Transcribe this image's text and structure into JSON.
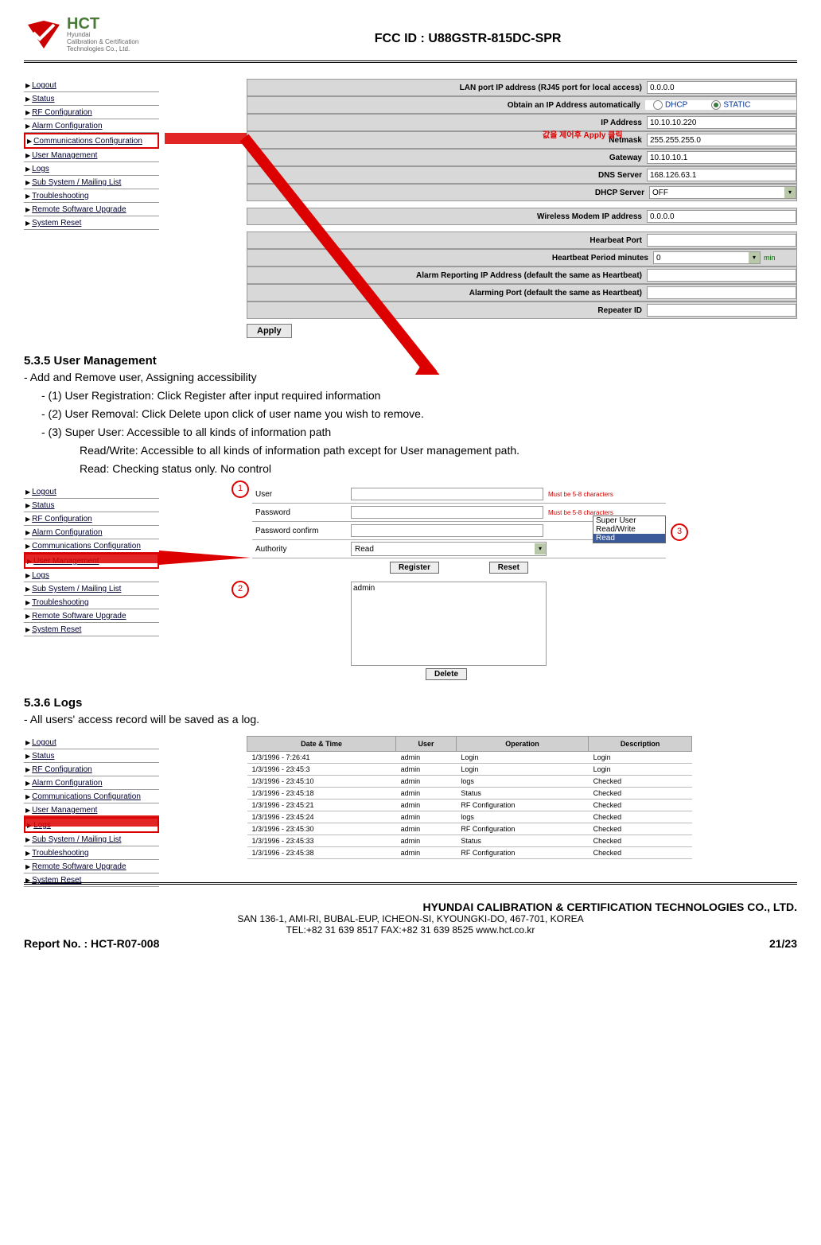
{
  "header": {
    "logo_main": "HCT",
    "logo_sub1": "Hyundai",
    "logo_sub2": "Calibration & Certification",
    "logo_sub3": "Technologies Co., Ltd.",
    "fcc_id": "FCC ID : U88GSTR-815DC-SPR"
  },
  "menu1": [
    "Logout",
    "Status",
    "RF Configuration",
    "Alarm Configuration",
    "Communications Configuration",
    "User Management",
    "Logs",
    "Sub System / Mailing List",
    "Troubleshooting",
    "Remote Software Upgrade",
    "System Reset"
  ],
  "menu1_highlight": 4,
  "comm_form": {
    "rows": [
      {
        "label": "LAN port IP address (RJ45 port for local access)",
        "value": "0.0.0.0",
        "type": "text"
      },
      {
        "label": "Obtain an IP Address automatically",
        "type": "radio",
        "opt1": "DHCP",
        "opt2": "STATIC",
        "checked": "STATIC"
      },
      {
        "label": "IP Address",
        "value": "10.10.10.220",
        "type": "text"
      },
      {
        "label": "Netmask",
        "value": "255.255.255.0",
        "type": "text"
      },
      {
        "label": "Gateway",
        "value": "10.10.10.1",
        "type": "text"
      },
      {
        "label": "DNS Server",
        "value": "168.126.63.1",
        "type": "text"
      },
      {
        "label": "DHCP Server",
        "value": "OFF",
        "type": "select"
      }
    ],
    "overlay_text": "값을 제어후 Apply 클릭",
    "wireless_label": "Wireless Modem IP address",
    "wireless_value": "0.0.0.0",
    "rows2": [
      {
        "label": "Hearbeat Port",
        "value": ""
      },
      {
        "label": "Heartbeat Period minutes",
        "value": "0",
        "unit": "min",
        "type": "select"
      },
      {
        "label": "Alarm Reporting IP Address (default the same as Heartbeat)",
        "value": ""
      },
      {
        "label": "Alarming Port (default the same as Heartbeat)",
        "value": ""
      },
      {
        "label": "Repeater ID",
        "value": ""
      }
    ],
    "apply_label": "Apply"
  },
  "section535": {
    "heading": "5.3.5 User Management",
    "line1": "-  Add and Remove user, Assigning accessibility",
    "line2": "-  (1) User Registration:  Click  Register  after input required information",
    "line3": "-  (2) User Removal:  Click Delete upon click of user name you wish to remove.",
    "line4": "-  (3)  Super  User:  Accessible to all kinds of information path",
    "line5": "Read/Write:  Accessible to all kinds of information path except for User  management  path.",
    "line6": "Read:  Checking status only. No control"
  },
  "menu2": [
    "Logout",
    "Status",
    "RF Configuration",
    "Alarm Configuration",
    "Communications Configuration",
    "User Management",
    "Logs",
    "Sub System / Mailing List",
    "Troubleshooting",
    "Remote Software Upgrade",
    "System Reset"
  ],
  "menu2_highlight": 5,
  "user_form": {
    "user_label": "User",
    "password_label": "Password",
    "confirm_label": "Password confirm",
    "auth_label": "Authority",
    "auth_value": "Read",
    "hint": "Must be 5-8 characters",
    "register": "Register",
    "reset": "Reset",
    "delete": "Delete",
    "userlist": [
      "admin"
    ],
    "dropdown": [
      "Super User",
      "Read/Write",
      "Read"
    ],
    "dropdown_sel": "Read"
  },
  "section536": {
    "heading": "5.3.6 Logs",
    "line1": "-  All users' access record will be saved as a log."
  },
  "menu3": [
    "Logout",
    "Status",
    "RF Configuration",
    "Alarm Configuration",
    "Communications Configuration",
    "User Management",
    "Logs",
    "Sub System / Mailing List",
    "Troubleshooting",
    "Remote Software Upgrade",
    "System Reset"
  ],
  "menu3_highlight": 6,
  "logs_table": {
    "headers": [
      "Date & Time",
      "User",
      "Operation",
      "Description"
    ],
    "rows": [
      [
        "1/3/1996 - 7:26:41",
        "admin",
        "Login",
        "Login"
      ],
      [
        "1/3/1996 - 23:45:3",
        "admin",
        "Login",
        "Login"
      ],
      [
        "1/3/1996 - 23:45:10",
        "admin",
        "logs",
        "Checked"
      ],
      [
        "1/3/1996 - 23:45:18",
        "admin",
        "Status",
        "Checked"
      ],
      [
        "1/3/1996 - 23:45:21",
        "admin",
        "RF Configuration",
        "Checked"
      ],
      [
        "1/3/1996 - 23:45:24",
        "admin",
        "logs",
        "Checked"
      ],
      [
        "1/3/1996 - 23:45:30",
        "admin",
        "RF Configuration",
        "Checked"
      ],
      [
        "1/3/1996 - 23:45:33",
        "admin",
        "Status",
        "Checked"
      ],
      [
        "1/3/1996 - 23:45:38",
        "admin",
        "RF Configuration",
        "Checked"
      ]
    ]
  },
  "footer": {
    "company": "HYUNDAI CALIBRATION & CERTIFICATION TECHNOLOGIES CO., LTD.",
    "address": "SAN 136-1, AMI-RI, BUBAL-EUP, ICHEON-SI, KYOUNGKI-DO, 467-701, KOREA",
    "contact": "TEL:+82 31 639 8517       FAX:+82 31 639 8525       www.hct.co.kr",
    "report_label": "Report No. :    HCT-R07-008",
    "page": "21/23"
  }
}
